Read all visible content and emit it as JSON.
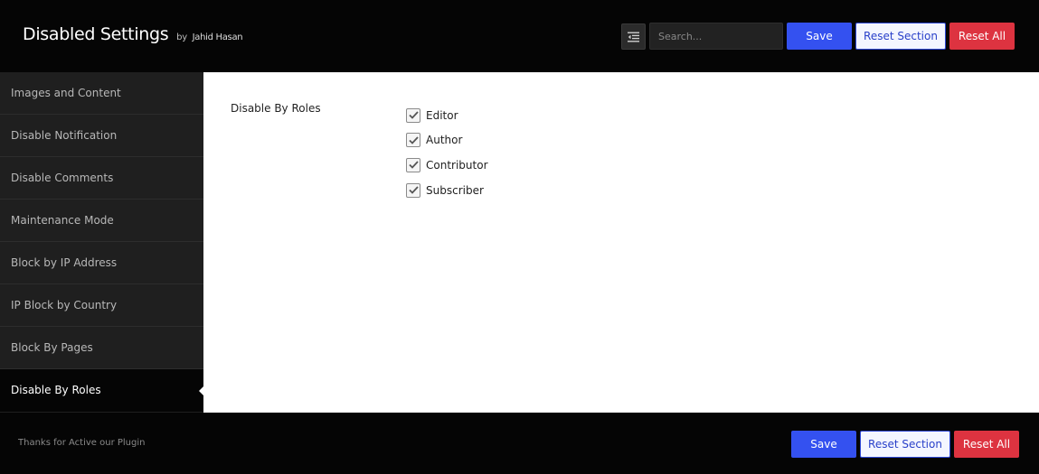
{
  "header": {
    "title": "Disabled Settings",
    "by_prefix": "by",
    "author": "Jahid Hasan",
    "expand_icon": "expand-collapse-icon",
    "search_placeholder": "Search...",
    "save_label": "Save",
    "reset_section_label": "Reset Section",
    "reset_all_label": "Reset All"
  },
  "sidebar": {
    "items": [
      {
        "label": "Images and Content"
      },
      {
        "label": "Disable Notification"
      },
      {
        "label": "Disable Comments"
      },
      {
        "label": "Maintenance Mode"
      },
      {
        "label": "Block by IP Address"
      },
      {
        "label": "IP Block by Country"
      },
      {
        "label": "Block By Pages"
      },
      {
        "label": "Disable By Roles",
        "active": true
      }
    ]
  },
  "content": {
    "field_label": "Disable By Roles",
    "roles": [
      {
        "label": "Editor",
        "checked": true
      },
      {
        "label": "Author",
        "checked": true
      },
      {
        "label": "Contributor",
        "checked": true
      },
      {
        "label": "Subscriber",
        "checked": true
      }
    ]
  },
  "footer": {
    "text": "Thanks for Active our Plugin",
    "save_label": "Save",
    "reset_section_label": "Reset Section",
    "reset_all_label": "Reset All"
  },
  "colors": {
    "primary": "#3451f0",
    "danger": "#dd3340",
    "sidebar_bg": "#1f1f1f",
    "header_bg": "#050505"
  }
}
